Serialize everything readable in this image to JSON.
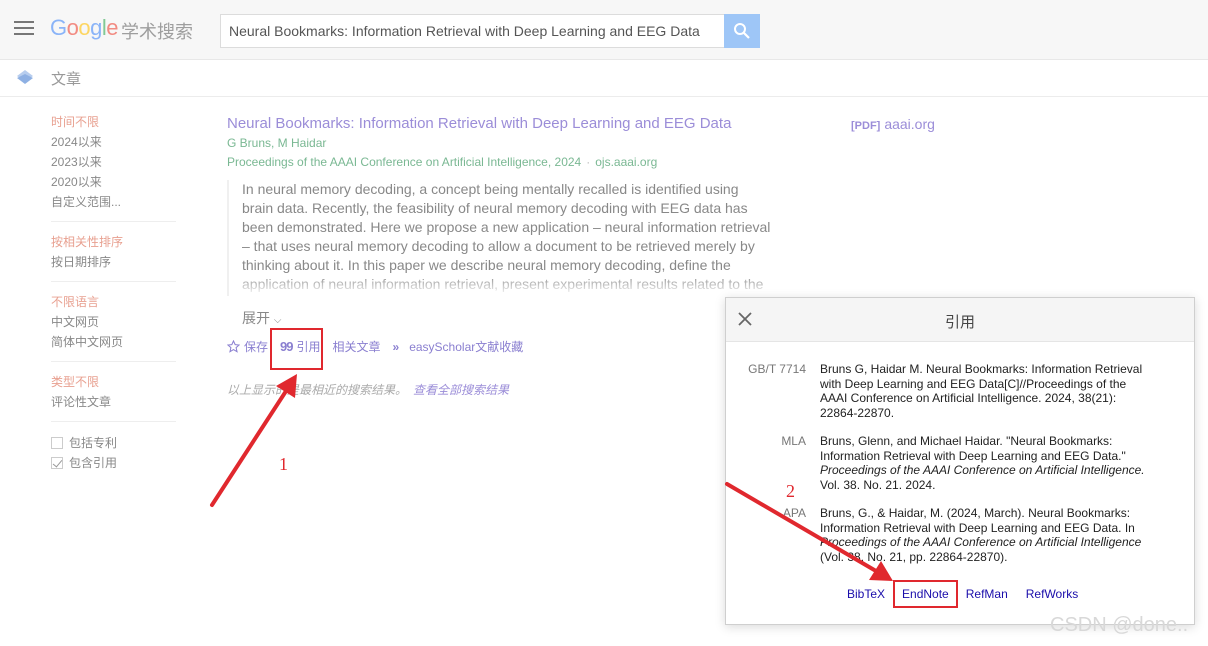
{
  "header": {
    "logo_suffix": "学术搜索",
    "search_value": "Neural Bookmarks: Information Retrieval with Deep Learning and EEG Data"
  },
  "subbar": {
    "label": "文章"
  },
  "sidebar": {
    "time": [
      "时间不限",
      "2024以来",
      "2023以来",
      "2020以来",
      "自定义范围..."
    ],
    "sort": [
      "按相关性排序",
      "按日期排序"
    ],
    "lang": [
      "不限语言",
      "中文网页",
      "简体中文网页"
    ],
    "type": [
      "类型不限",
      "评论性文章"
    ],
    "checks": [
      {
        "label": "包括专利",
        "checked": false
      },
      {
        "label": "包含引用",
        "checked": true
      }
    ]
  },
  "result": {
    "title": "Neural Bookmarks: Information Retrieval with Deep Learning and EEG Data",
    "authors": "G Bruns, M Haidar",
    "venue": "Proceedings of the AAAI Conference on Artificial Intelligence, 2024",
    "source": "ojs.aaai.org",
    "snippet": "In neural memory decoding, a concept being mentally recalled is identified using brain data. Recently, the feasibility of neural memory decoding with EEG data has been demonstrated. Here we propose a new application – neural information retrieval – that uses neural memory decoding to allow a document to be retrieved merely by thinking about it. In this paper we describe neural memory decoding, define the application of neural information retrieval, present experimental results related to the practicality of the",
    "expand": "展开",
    "actions": {
      "save": "保存",
      "cite": "引用",
      "related": "相关文章",
      "easyscholar": "easyScholar文献收藏"
    },
    "footnote": "以上显示的是最相近的搜索结果。",
    "footnote_link": "查看全部搜索结果",
    "pdf_tag": "[PDF]",
    "pdf_domain": "aaai.org"
  },
  "cite_dialog": {
    "title": "引用",
    "rows": [
      {
        "format": "GB/T 7714",
        "text": "Bruns G, Haidar M. Neural Bookmarks: Information Retrieval with Deep Learning and EEG Data[C]//Proceedings of the AAAI Conference on Artificial Intelligence. 2024, 38(21): 22864-22870."
      },
      {
        "format": "MLA",
        "pre": "Bruns, Glenn, and Michael Haidar. \"Neural Bookmarks: Information Retrieval with Deep Learning and EEG Data.\" ",
        "ital": "Proceedings of the AAAI Conference on Artificial Intelligence.",
        "post": " Vol. 38. No. 21. 2024."
      },
      {
        "format": "APA",
        "pre": "Bruns, G., & Haidar, M. (2024, March). Neural Bookmarks: Information Retrieval with Deep Learning and EEG Data. In ",
        "ital": "Proceedings of the AAAI Conference on Artificial Intelligence",
        "post": " (Vol. 38, No. 21, pp. 22864-22870)."
      }
    ],
    "exports": [
      "BibTeX",
      "EndNote",
      "RefMan",
      "RefWorks"
    ]
  },
  "annotations": {
    "step1": "1",
    "step2": "2"
  },
  "watermark": "CSDN @done..",
  "colors": {
    "accent": "#9b8dd8",
    "annotation": "#e0282e",
    "green": "#7ab893"
  }
}
